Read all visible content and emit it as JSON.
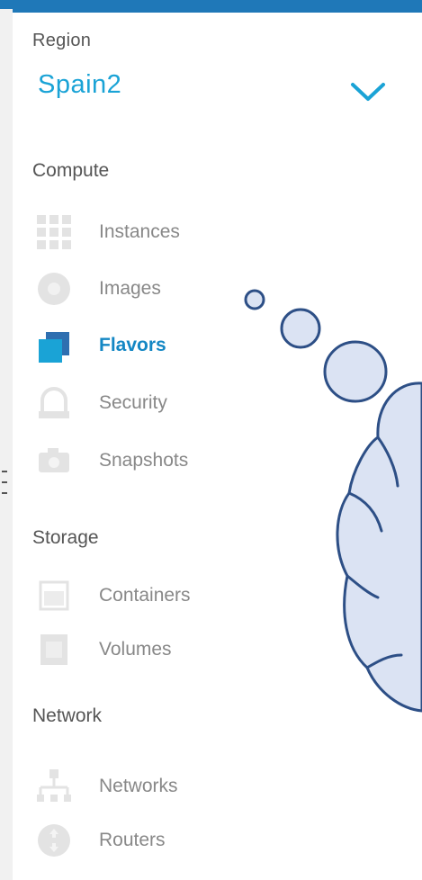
{
  "region": {
    "label": "Region",
    "value": "Spain2"
  },
  "sections": [
    {
      "heading": "Compute",
      "items": [
        {
          "label": "Instances",
          "icon": "grid-icon"
        },
        {
          "label": "Images",
          "icon": "disc-icon"
        },
        {
          "label": "Flavors",
          "icon": "flavors-icon",
          "active": true
        },
        {
          "label": "Security",
          "icon": "lock-icon"
        },
        {
          "label": "Snapshots",
          "icon": "camera-icon"
        }
      ]
    },
    {
      "heading": "Storage",
      "items": [
        {
          "label": "Containers",
          "icon": "container-icon"
        },
        {
          "label": "Volumes",
          "icon": "volume-icon"
        }
      ]
    },
    {
      "heading": "Network",
      "items": [
        {
          "label": "Networks",
          "icon": "network-tree-icon"
        },
        {
          "label": "Routers",
          "icon": "router-icon"
        }
      ]
    }
  ],
  "colors": {
    "accent": "#1aa3d6",
    "active": "#1487c4",
    "heading": "#555555",
    "item": "#888888",
    "top_bar": "#1f78b8",
    "cloud_fill": "#dbe3f3",
    "cloud_stroke": "#2d4f86"
  }
}
